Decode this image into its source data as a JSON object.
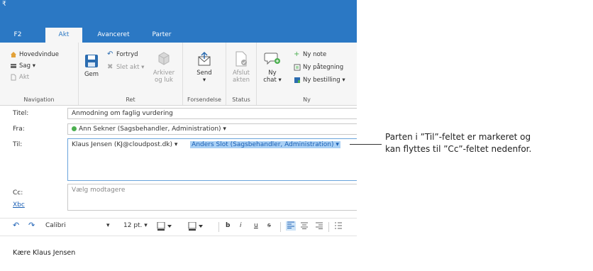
{
  "quick_access": "₹",
  "tabs": [
    {
      "label": "F2"
    },
    {
      "label": "Akt"
    },
    {
      "label": "Avanceret"
    },
    {
      "label": "Parter"
    }
  ],
  "ribbon": {
    "navigation": {
      "items": [
        "Hovedvindue",
        "Sag ▾",
        "Akt"
      ],
      "label": "Navigation"
    },
    "ret": {
      "gem": "Gem",
      "fortryd": "Fortryd",
      "slet_akt": "Slet akt ▾",
      "arkiver_line1": "Arkiver",
      "arkiver_line2": "og luk",
      "label": "Ret"
    },
    "forsendelse": {
      "send": "Send",
      "send_arrow": "▾",
      "label": "Forsendelse"
    },
    "status": {
      "afslut_line1": "Afslut",
      "afslut_line2": "akten",
      "label": "Status"
    },
    "ny": {
      "ny_chat_line1": "Ny",
      "ny_chat_line2": "chat ▾",
      "ny_note": "Ny note",
      "ny_paategning": "Ny påtegning",
      "ny_bestilling": "Ny bestilling ▾",
      "label": "Ny"
    }
  },
  "form": {
    "titel_label": "Titel:",
    "titel_value": "Anmodning om faglig vurdering",
    "fra_label": "Fra:",
    "fra_value": "Ann Sekner (Sagsbehandler, Administration) ▾",
    "til_label": "Til:",
    "til_recipient1": "Klaus Jensen (KJ@cloudpost.dk) ▾",
    "til_recipient2": "Anders Slot (Sagsbehandler, Administration) ▾",
    "cc_label": "Cc:",
    "cc_placeholder": "Vælg modtagere",
    "xbc_label": "Xbc"
  },
  "format_toolbar": {
    "font": "Calibri",
    "font_arrow": "▾",
    "size": "12 pt. ▾",
    "bold": "b",
    "italic": "i",
    "underline": "u",
    "strike": "s"
  },
  "body_text": "Kære Klaus Jensen",
  "callout": {
    "line1": "Parten i ”Til”-feltet er markeret og",
    "line2": "kan flyttes til ”Cc”-feltet nedenfor."
  },
  "colors": {
    "accent": "#2b78c4",
    "selection": "#a9d0f5",
    "presence": "#4caf50"
  }
}
